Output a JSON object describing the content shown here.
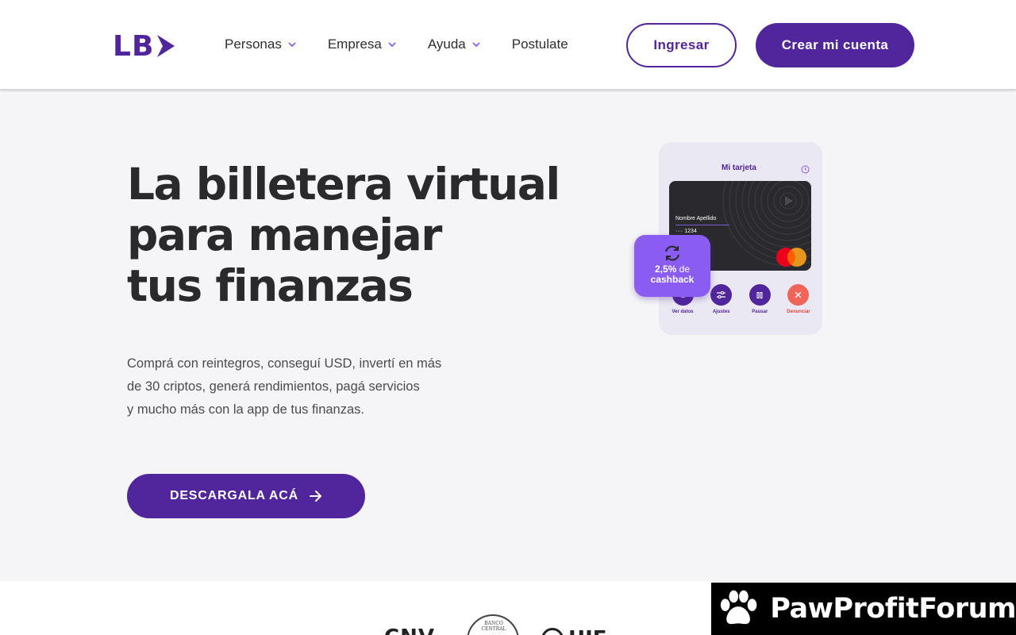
{
  "header": {
    "logo_text": "LB",
    "nav": [
      {
        "label": "Personas",
        "has_dropdown": true
      },
      {
        "label": "Empresa",
        "has_dropdown": true
      },
      {
        "label": "Ayuda",
        "has_dropdown": true
      },
      {
        "label": "Postulate",
        "has_dropdown": false
      }
    ],
    "login_label": "Ingresar",
    "signup_label": "Crear mi cuenta"
  },
  "hero": {
    "title_lines": [
      "La billetera virtual",
      "para manejar",
      "tus finanzas"
    ],
    "description_lines": [
      "Comprá con reintegros, conseguí USD, invertí en más",
      "de 30 criptos, generá rendimientos, pagá servicios",
      "y mucho más con la app de tus finanzas."
    ],
    "download_label": "DESCARGALA ACÁ"
  },
  "phone_card": {
    "title": "Mi tarjeta",
    "cardholder": "Nombre Apellido",
    "card_number": "···· 1234",
    "cashback_value": "2,5%",
    "cashback_word": "de",
    "cashback_label": "cashback",
    "actions": [
      {
        "label": "Ver datos",
        "icon": "eye-icon"
      },
      {
        "label": "Ajustes",
        "icon": "sliders-icon"
      },
      {
        "label": "Pausar",
        "icon": "pause-icon"
      },
      {
        "label": "Denunciar",
        "icon": "close-icon"
      }
    ]
  },
  "partners": {
    "cnv": "CNV",
    "bcra": "BANCO CENTRAL",
    "uif": "UIF"
  },
  "watermark": {
    "text": "PawProfitForum"
  },
  "colors": {
    "brand": "#51259c",
    "brand_light": "#8a5cf2",
    "danger": "#f0645a",
    "background": "#f5f5f7"
  }
}
